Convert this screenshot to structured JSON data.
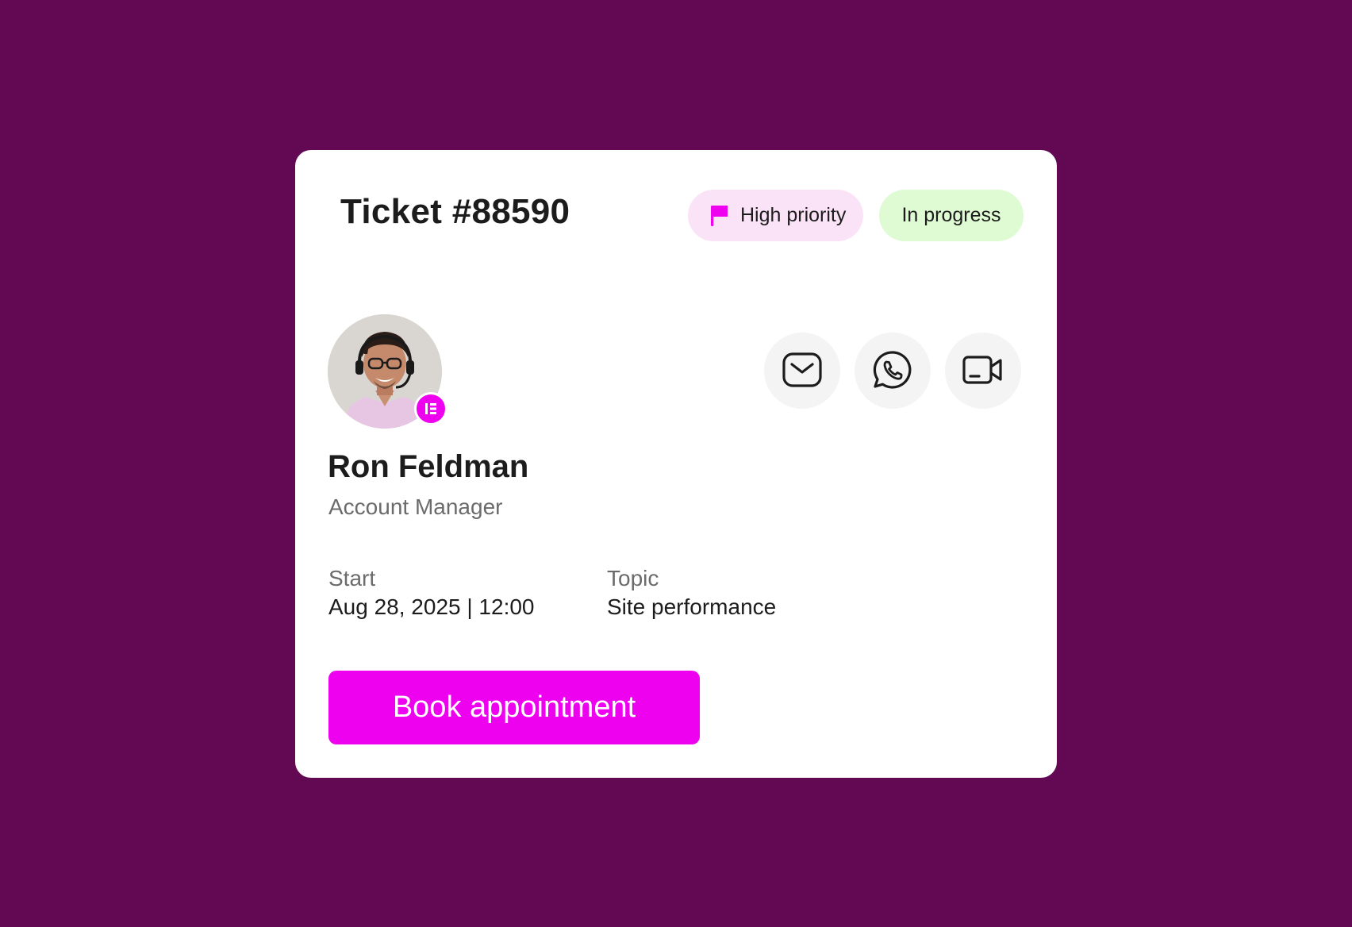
{
  "ticket": {
    "title": "Ticket #88590",
    "priority_label": "High priority",
    "status_label": "In progress"
  },
  "agent": {
    "name": "Ron Feldman",
    "role": "Account Manager"
  },
  "contact_actions": [
    {
      "icon": "email-icon"
    },
    {
      "icon": "whatsapp-icon"
    },
    {
      "icon": "video-call-icon"
    }
  ],
  "details": {
    "start_label": "Start",
    "start_value": "Aug 28, 2025 | 12:00",
    "topic_label": "Topic",
    "topic_value": "Site performance"
  },
  "cta": {
    "label": "Book appointment"
  },
  "colors": {
    "background": "#630954",
    "accent": "#ed01ee",
    "priority_badge_bg": "#fbe3f7",
    "status_badge_bg": "#dffbd3"
  }
}
